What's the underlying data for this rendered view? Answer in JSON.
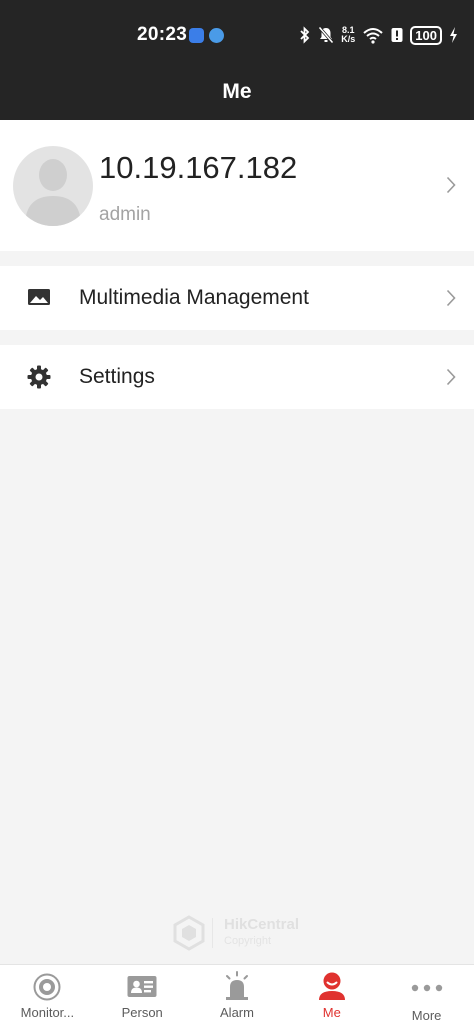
{
  "status_bar": {
    "time": "20:23",
    "net_speed_value": "8.1",
    "net_speed_unit": "K/s",
    "battery": "100"
  },
  "header": {
    "title": "Me"
  },
  "profile": {
    "name": "10.19.167.182",
    "role": "admin"
  },
  "menu": [
    {
      "label": "Multimedia Management",
      "icon": "image-icon"
    },
    {
      "label": "Settings",
      "icon": "gear-icon"
    }
  ],
  "watermark": {
    "brand": "HikCentral",
    "copyright": "Copyright"
  },
  "tabs": [
    {
      "label": "Monitor...",
      "icon": "camera-icon",
      "active": false
    },
    {
      "label": "Person",
      "icon": "id-card-icon",
      "active": false
    },
    {
      "label": "Alarm",
      "icon": "siren-icon",
      "active": false
    },
    {
      "label": "Me",
      "icon": "user-icon",
      "active": true
    },
    {
      "label": "More",
      "icon": "more-icon",
      "active": false
    }
  ],
  "colors": {
    "header_bg": "#252525",
    "accent": "#e0322f",
    "page_bg": "#f4f4f4",
    "tab_inactive": "#9a9a9a"
  }
}
